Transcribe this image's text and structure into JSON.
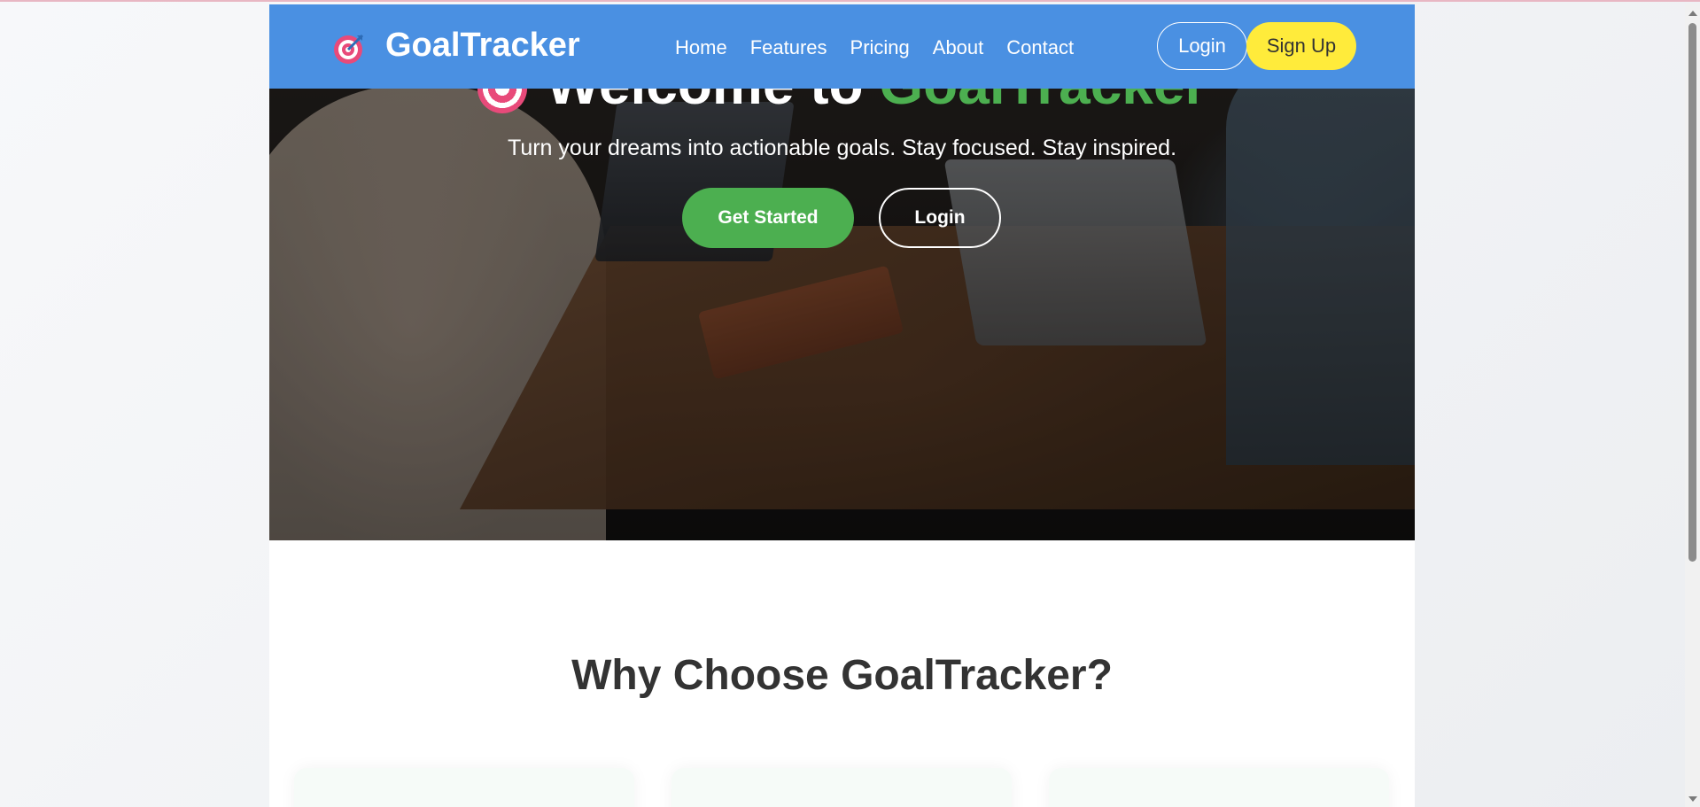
{
  "brand": {
    "name": "GoalTracker",
    "icon": "target-icon"
  },
  "nav": {
    "links": [
      "Home",
      "Features",
      "Pricing",
      "About",
      "Contact"
    ],
    "login_label": "Login",
    "signup_label": "Sign Up"
  },
  "hero": {
    "title_prefix": "Welcome to ",
    "title_accent": "GoalTracker",
    "subtitle": "Turn your dreams into actionable goals. Stay focused. Stay inspired.",
    "primary_button": "Get Started",
    "secondary_button": "Login"
  },
  "features": {
    "title": "Why Choose GoalTracker?"
  },
  "colors": {
    "navbar": "#4a90e2",
    "accent_green": "#4caf50",
    "signup_yellow": "#ffeb3b",
    "text_dark": "#333333"
  }
}
